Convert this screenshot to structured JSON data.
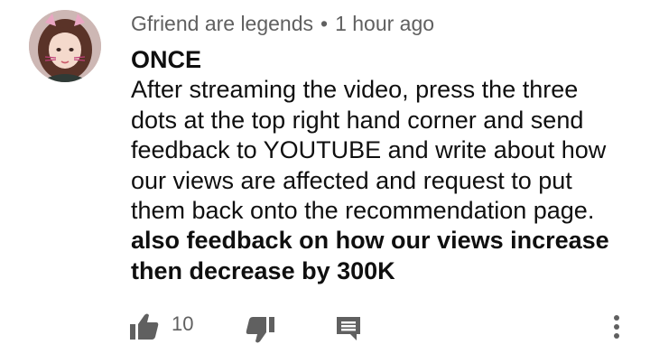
{
  "comment": {
    "author": "Gfriend are legends",
    "separator": "•",
    "time": "1 hour ago",
    "lines": [
      "ONCE",
      "After streaming the video, press the three",
      "dots at the top right hand corner and send",
      "feedback to YOUTUBE and write about how",
      "our views are affected and request to put",
      "them back onto the recommendation page.",
      "also feedback on how our views increase",
      "then decrease by 300K"
    ],
    "like_count": "10",
    "icons": {
      "like": "thumbs-up-icon",
      "dislike": "thumbs-down-icon",
      "reply": "reply-comment-icon",
      "menu": "more-vertical-icon"
    },
    "colors": {
      "text": "#0f0f0f",
      "meta": "#606060",
      "icon": "#606060"
    }
  }
}
